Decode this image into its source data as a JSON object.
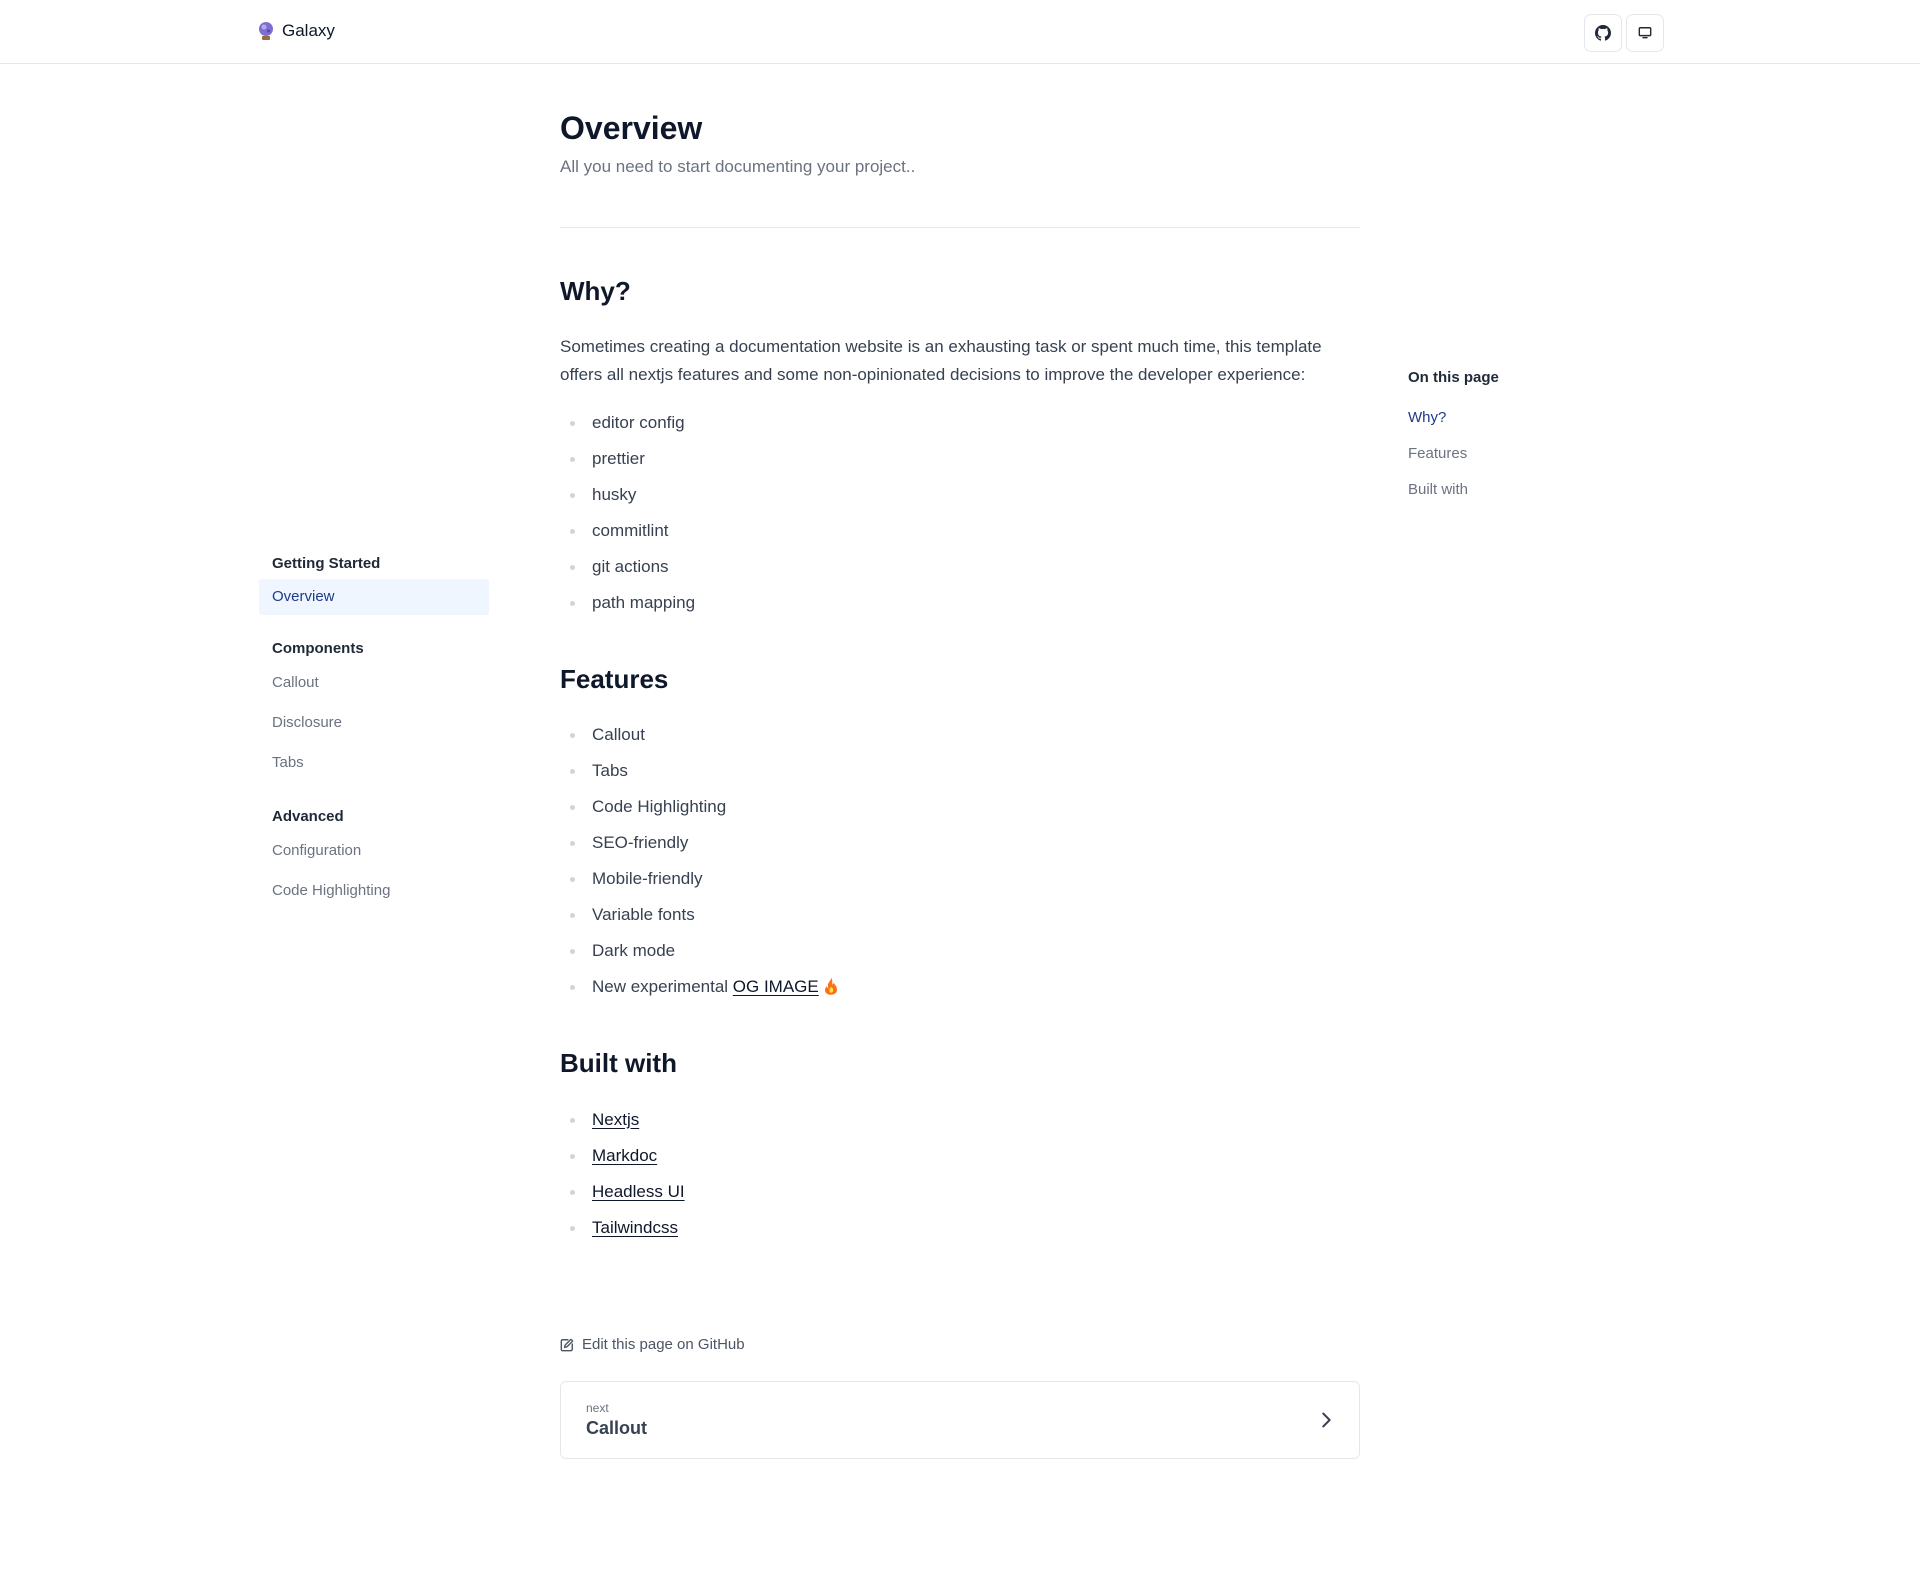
{
  "header": {
    "brand_name": "Galaxy",
    "github_button": "github-icon",
    "theme_button": "monitor-icon"
  },
  "sidebar": {
    "sections": [
      {
        "heading": "Getting Started",
        "items": [
          {
            "label": "Overview",
            "active": true
          }
        ]
      },
      {
        "heading": "Components",
        "items": [
          {
            "label": "Callout"
          },
          {
            "label": "Disclosure"
          },
          {
            "label": "Tabs"
          }
        ]
      },
      {
        "heading": "Advanced",
        "items": [
          {
            "label": "Configuration"
          },
          {
            "label": "Code Highlighting"
          }
        ]
      }
    ]
  },
  "main": {
    "title": "Overview",
    "subtitle": "All you need to start documenting your project..",
    "why": {
      "heading": "Why?",
      "paragraph": "Sometimes creating a documentation website is an exhausting task or spent much time, this template offers all nextjs features and some non-opinionated decisions to improve the developer experience:",
      "items": [
        "editor config",
        "prettier",
        "husky",
        "commitlint",
        "git actions",
        "path mapping"
      ]
    },
    "features": {
      "heading": "Features",
      "items": [
        "Callout",
        "Tabs",
        "Code Highlighting",
        "SEO-friendly",
        "Mobile-friendly",
        "Variable fonts",
        "Dark mode"
      ],
      "last_item_prefix": "New experimental ",
      "last_item_link": "OG IMAGE"
    },
    "built_with": {
      "heading": "Built with",
      "links": [
        "Nextjs",
        "Markdoc",
        "Headless UI",
        "Tailwindcss"
      ]
    },
    "edit_link": "Edit this page on GitHub",
    "next": {
      "small": "next",
      "title": "Callout"
    }
  },
  "toc": {
    "heading": "On this page",
    "items": [
      {
        "label": "Why?",
        "active": true
      },
      {
        "label": "Features"
      },
      {
        "label": "Built with"
      }
    ]
  },
  "colors": {
    "accent": "#1e3a8a",
    "active_bg": "#eff6ff",
    "border": "#e5e7eb",
    "muted_text": "#6b7280"
  }
}
